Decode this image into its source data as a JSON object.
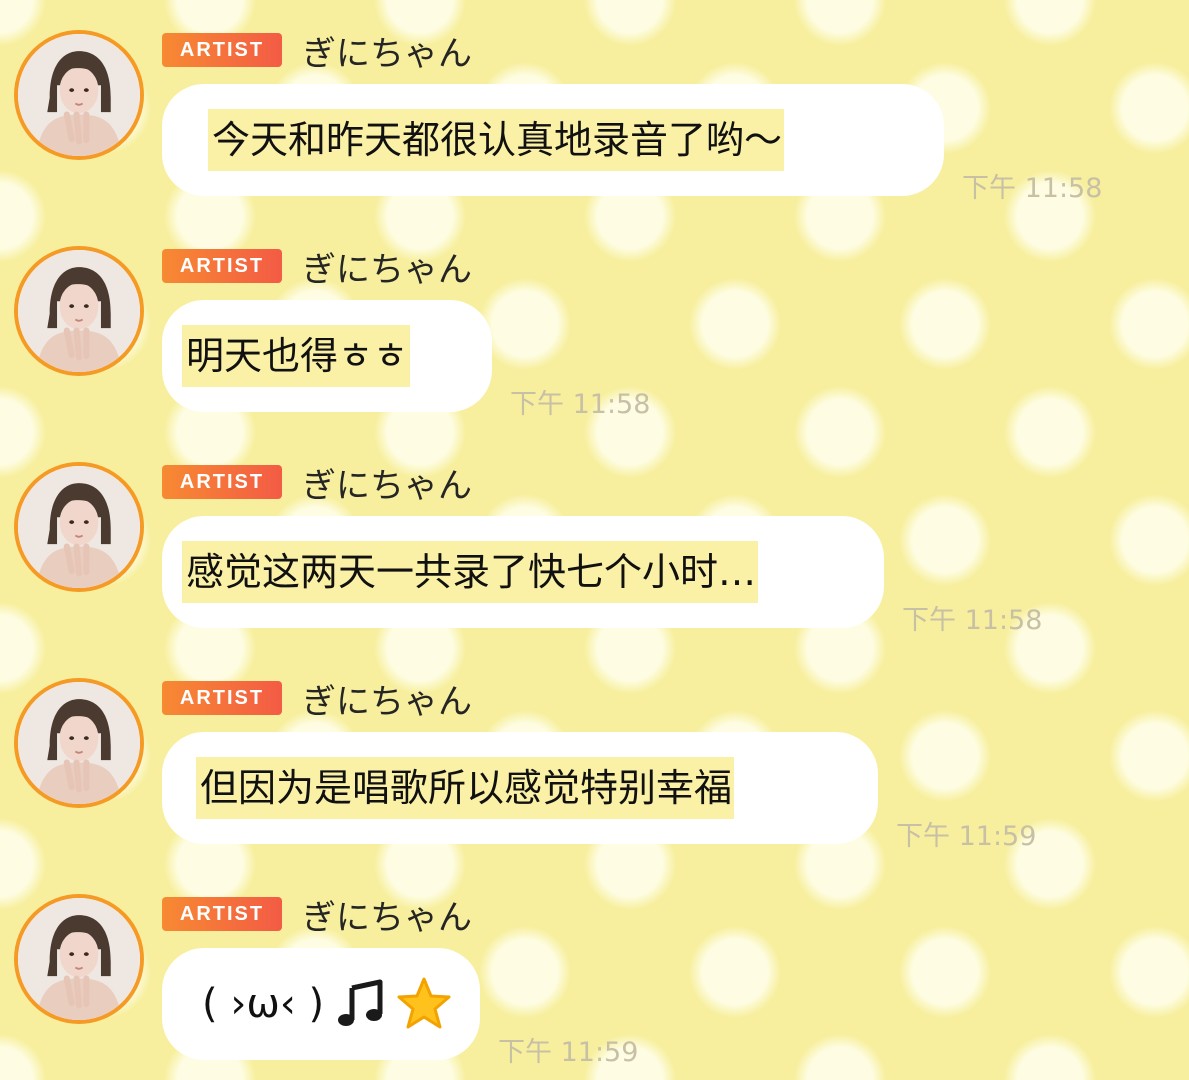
{
  "messages": [
    {
      "badge": "ARTIST",
      "sender": "ぎにちゃん",
      "text": "今天和昨天都很认真地录音了哟～",
      "time": "下午 11:58"
    },
    {
      "badge": "ARTIST",
      "sender": "ぎにちゃん",
      "text": "明天也得ㅎㅎ",
      "time": "下午 11:58"
    },
    {
      "badge": "ARTIST",
      "sender": "ぎにちゃん",
      "text": "感觉这两天一共录了快七个小时…",
      "time": "下午 11:58"
    },
    {
      "badge": "ARTIST",
      "sender": "ぎにちゃん",
      "text": "但因为是唱歌所以感觉特别幸福",
      "time": "下午 11:59"
    },
    {
      "badge": "ARTIST",
      "sender": "ぎにちゃん",
      "text": "( ›ω‹ )",
      "time": "下午 11:59",
      "icons": [
        "music-note-icon",
        "star-icon"
      ]
    }
  ],
  "colors": {
    "background": "#f7ef9e",
    "badge": "#f47a3a",
    "avatar_ring": "#f59a25",
    "bubble": "#ffffff",
    "text_highlight": "#faf1a7",
    "timestamp": "#c7c0a5"
  }
}
